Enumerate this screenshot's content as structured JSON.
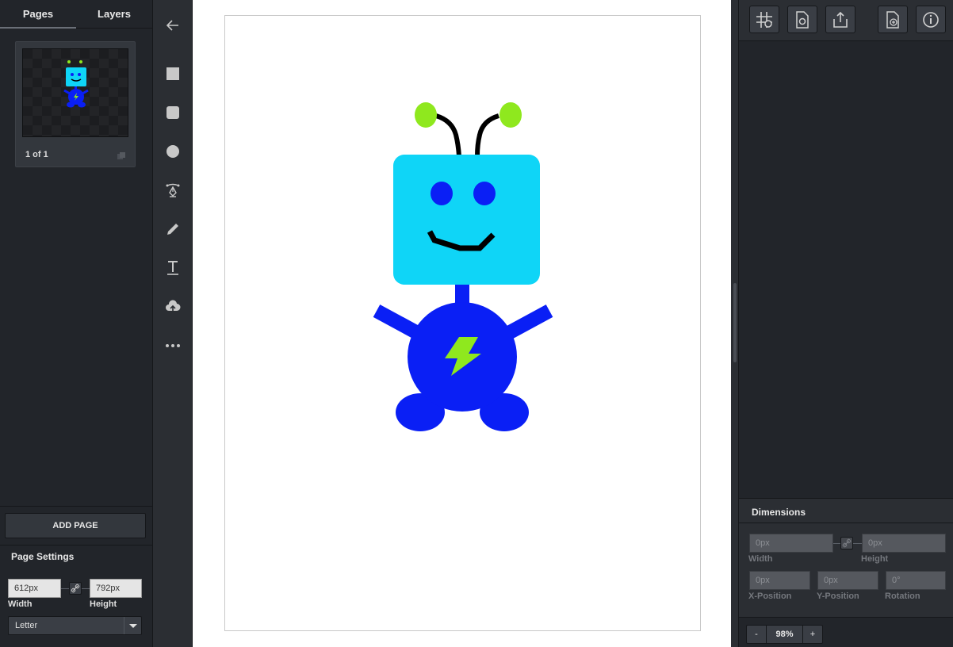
{
  "left_panel": {
    "tabs": [
      {
        "label": "Pages",
        "active": true
      },
      {
        "label": "Layers",
        "active": false
      }
    ],
    "page_thumbnail": {
      "label": "1 of 1"
    },
    "add_page_label": "ADD PAGE",
    "page_settings": {
      "title": "Page Settings",
      "width_value": "612px",
      "height_value": "792px",
      "width_label": "Width",
      "height_label": "Height",
      "size_preset": "Letter"
    }
  },
  "tools": [
    "back-arrow-icon",
    "square-icon",
    "rounded-square-icon",
    "circle-icon",
    "pen-tool-icon",
    "pencil-icon",
    "text-icon",
    "upload-cloud-icon",
    "more-icon"
  ],
  "right_panel": {
    "toolbar": [
      "grid-settings-icon",
      "page-settings-icon",
      "export-icon",
      "add-page-file-icon",
      "info-icon"
    ],
    "dimensions": {
      "title": "Dimensions",
      "width_value": "0px",
      "height_value": "0px",
      "x_value": "0px",
      "y_value": "0px",
      "rotation_value": "0°",
      "width_label": "Width",
      "height_label": "Height",
      "x_label": "X-Position",
      "y_label": "Y-Position",
      "rotation_label": "Rotation"
    },
    "zoom": {
      "minus": "-",
      "value": "98%",
      "plus": "+"
    }
  },
  "colors": {
    "robot_head": "#0fd5f7",
    "robot_body": "#0a1ff5",
    "antenna_ball": "#8fe81e",
    "lightning": "#8fe81e",
    "stroke": "#000000"
  }
}
